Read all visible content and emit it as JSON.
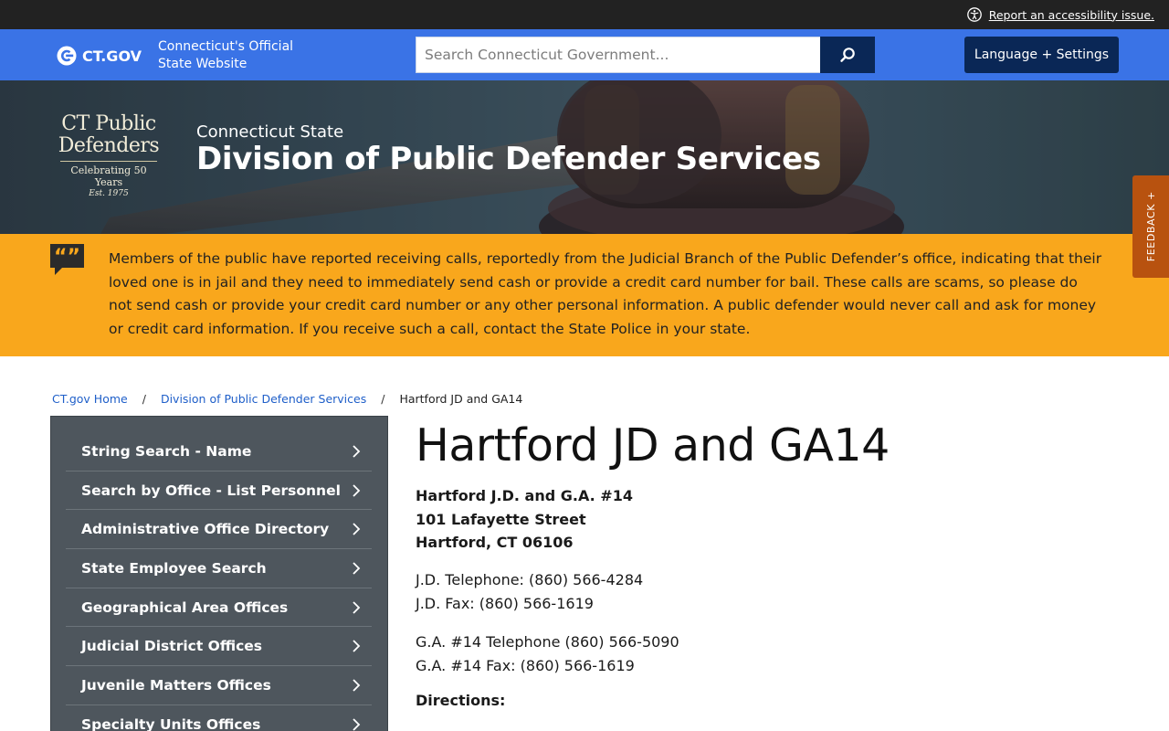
{
  "utility": {
    "accessibility_link": "Report an accessibility issue."
  },
  "header": {
    "logo_text": "CT.GOV",
    "tagline": "Connecticut's Official State Website",
    "search_placeholder": "Search Connecticut Government...",
    "language_button": "Language + Settings"
  },
  "hero": {
    "logo_line1": "CT Public",
    "logo_line2": "Defenders",
    "logo_line3": "Celebrating 50 Years",
    "logo_line4": "Est. 1975",
    "subtitle": "Connecticut State",
    "title": "Division of Public Defender Services"
  },
  "feedback": {
    "label": "FEEDBACK +"
  },
  "alert": {
    "text": "Members of the public have reported receiving calls, reportedly from the Judicial Branch of the Public Defender’s office, indicating that their loved one is in jail and they need to immediately send cash or provide a credit card number for bail. These calls are scams, so please do not send cash or provide your credit card number or any other personal information. A public defender would never call and ask for money or credit card information. If you receive such a call, contact the State Police in your state."
  },
  "breadcrumb": {
    "items": [
      "CT.gov Home",
      "Division of Public Defender Services"
    ],
    "current": "Hartford JD and GA14"
  },
  "sidebar": {
    "items": [
      {
        "label": "String Search - Name"
      },
      {
        "label": "Search by Office - List Personnel"
      },
      {
        "label": "Administrative Office Directory"
      },
      {
        "label": "State Employee Search"
      },
      {
        "label": "Geographical Area Offices"
      },
      {
        "label": "Judicial District Offices"
      },
      {
        "label": "Juvenile Matters Offices"
      },
      {
        "label": "Specialty Units Offices"
      }
    ]
  },
  "main": {
    "title": "Hartford JD and GA14",
    "address": [
      "Hartford J.D. and G.A. #14",
      "101 Lafayette Street",
      "Hartford, CT 06106"
    ],
    "jd_phone": "J.D. Telephone: (860) 566-4284",
    "jd_fax": "J.D. Fax: (860) 566-1619",
    "ga_phone": "G.A. #14 Telephone (860) 566-5090",
    "ga_fax": "G.A. #14 Fax: (860) 566-1619",
    "directions_label": "Directions:"
  },
  "colors": {
    "util_bar": "#222222",
    "header_blue": "#3a73e6",
    "navy": "#0a2756",
    "alert_yellow": "#f9a71c",
    "sidebar_gray": "#4e565d",
    "feedback_orange": "#b8520f",
    "link_blue": "#1f5fc9"
  },
  "icons": [
    "accessibility-icon",
    "ct-logo-icon",
    "search-icon",
    "quote-bubble-icon",
    "chevron-right-icon"
  ]
}
